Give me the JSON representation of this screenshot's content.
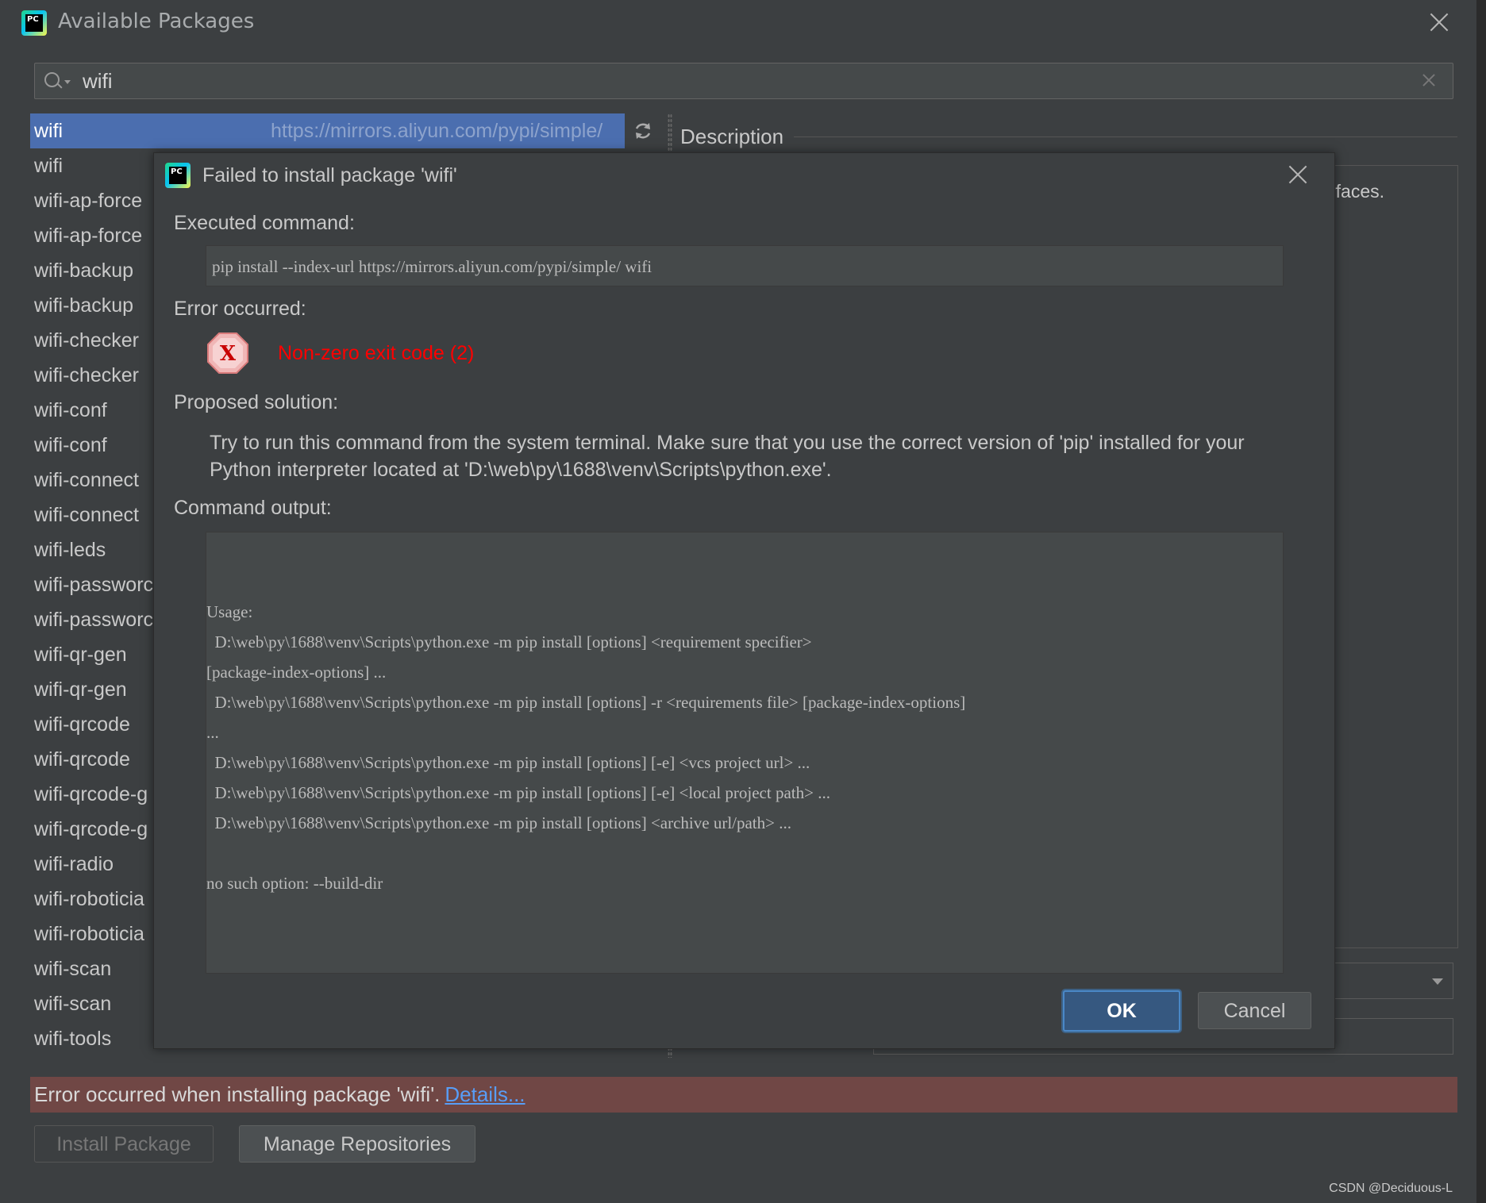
{
  "window": {
    "title": "Available Packages"
  },
  "search": {
    "value": "wifi"
  },
  "packages": {
    "selected": {
      "name": "wifi",
      "repo": "https://mirrors.aliyun.com/pypi/simple/"
    },
    "items": [
      "wifi",
      "wifi-ap-force",
      "wifi-ap-force",
      "wifi-backup",
      "wifi-backup",
      "wifi-checker",
      "wifi-checker",
      "wifi-conf",
      "wifi-conf",
      "wifi-connect",
      "wifi-connect",
      "wifi-leds",
      "wifi-passworc",
      "wifi-passworc",
      "wifi-qr-gen",
      "wifi-qr-gen",
      "wifi-qrcode",
      "wifi-qrcode",
      "wifi-qrcode-g",
      "wifi-qrcode-g",
      "wifi-radio",
      "wifi-roboticia",
      "wifi-roboticia",
      "wifi-scan",
      "wifi-scan",
      "wifi-tools"
    ]
  },
  "description": {
    "label": "Description",
    "partial_text": "rfaces."
  },
  "status_bar": {
    "message": "Error occurred when installing package 'wifi'.",
    "details_link": "Details..."
  },
  "buttons": {
    "install": "Install Package",
    "manage_repos": "Manage Repositories"
  },
  "watermark": "CSDN @Deciduous-L",
  "dialog": {
    "title": "Failed to install package 'wifi'",
    "executed_label": "Executed command:",
    "command": "pip install --index-url https://mirrors.aliyun.com/pypi/simple/ wifi",
    "error_label": "Error occurred:",
    "error_icon": "error-x-icon",
    "error_message": "Non-zero exit code (2)",
    "solution_label": "Proposed solution:",
    "solution_text": "Try to run this command from the system terminal. Make sure that you use the correct version of 'pip' installed for your Python interpreter located at 'D:\\web\\py\\1688\\venv\\Scripts\\python.exe'.",
    "output_label": "Command output:",
    "output_text": "Usage:\n  D:\\web\\py\\1688\\venv\\Scripts\\python.exe -m pip install [options] <requirement specifier>\n[package-index-options] ...\n  D:\\web\\py\\1688\\venv\\Scripts\\python.exe -m pip install [options] -r <requirements file> [package-index-options]\n...\n  D:\\web\\py\\1688\\venv\\Scripts\\python.exe -m pip install [options] [-e] <vcs project url> ...\n  D:\\web\\py\\1688\\venv\\Scripts\\python.exe -m pip install [options] [-e] <local project path> ...\n  D:\\web\\py\\1688\\venv\\Scripts\\python.exe -m pip install [options] <archive url/path> ...\n\nno such option: --build-dir",
    "ok": "OK",
    "cancel": "Cancel"
  },
  "colors": {
    "background": "#3c3f41",
    "selection": "#4b6eaf",
    "error_bar": "#704745",
    "error_text": "#ff0000",
    "link": "#589df6",
    "default_button": "#365880"
  }
}
